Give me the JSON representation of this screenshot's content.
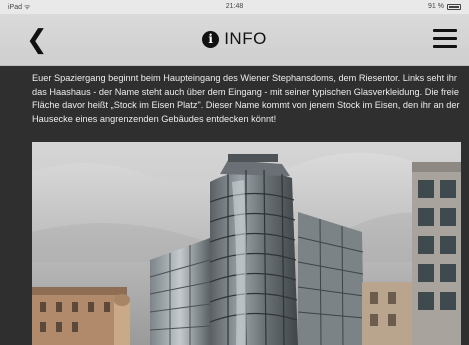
{
  "status_bar": {
    "carrier": "iPad ᯤ",
    "time": "21:48",
    "battery": "91 %"
  },
  "nav": {
    "back_icon": "chevron-left-icon",
    "info_icon": "info-icon",
    "title": "INFO",
    "menu_icon": "hamburger-menu-icon"
  },
  "content": {
    "text": "Euer Spaziergang beginnt beim Haupteingang des Wiener Stephansdoms, dem Riesentor. Links seht ihr das Haashaus - der Name steht auch über dem Eingang - mit seiner typischen Glasverkleidung. Die freie Fläche davor heißt „Stock im Eisen Platz\". Dieser Name kommt von jenem Stock im Eisen, den ihr an der Hausecke eines angrenzenden Gebäudes entdecken könnt!"
  },
  "colors": {
    "nav_background": "#d4d4d4",
    "content_background": "#2f2f2f",
    "text": "#ededed"
  }
}
